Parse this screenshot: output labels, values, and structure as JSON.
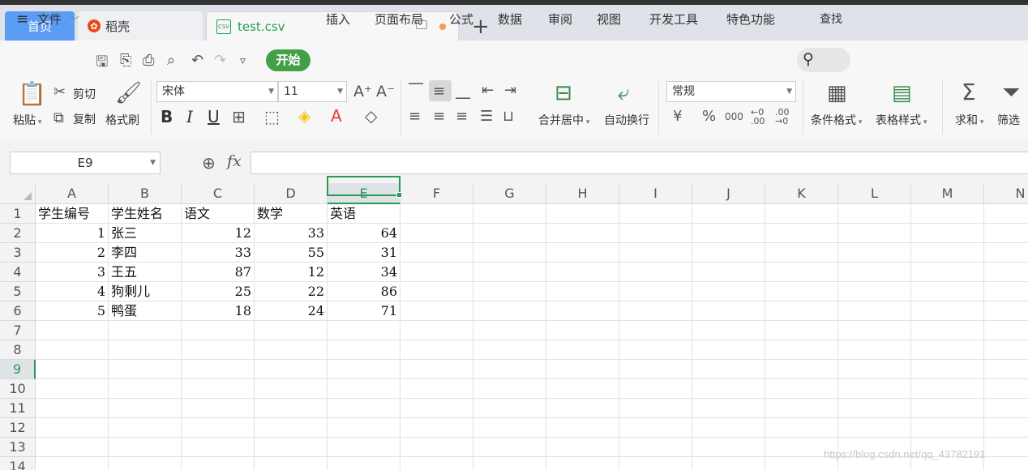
{
  "tabs": {
    "home": "首页",
    "docer": "稻壳",
    "file": "test.csv",
    "file_icon": "CSV",
    "new_tab": "+"
  },
  "menu": {
    "file": "文件",
    "start": "开始",
    "items": [
      "插入",
      "页面布局",
      "公式",
      "数据",
      "审阅",
      "视图",
      "开发工具",
      "特色功能"
    ],
    "search": "查找"
  },
  "ribbon": {
    "paste": "粘贴",
    "cut": "剪切",
    "copy": "复制",
    "format_painter": "格式刷",
    "font_name": "宋体",
    "font_size": "11",
    "merge_center": "合并居中",
    "wrap_text": "自动换行",
    "number_format": "常规",
    "conditional_format": "条件格式",
    "table_style": "表格样式",
    "sum": "求和",
    "filter": "筛选"
  },
  "formula_bar": {
    "name_box": "E9",
    "fx_label": "fx",
    "formula": ""
  },
  "sheet": {
    "columns": [
      "A",
      "B",
      "C",
      "D",
      "E",
      "F",
      "G",
      "H",
      "I",
      "J",
      "K",
      "L",
      "M",
      "N"
    ],
    "rows": [
      "1",
      "2",
      "3",
      "4",
      "5",
      "6",
      "7",
      "8",
      "9",
      "10",
      "11",
      "12",
      "13",
      "14"
    ],
    "selected_column": "E",
    "selected_row": "9",
    "header": [
      "学生编号",
      "学生姓名",
      "语文",
      "数学",
      "英语"
    ],
    "data": [
      [
        "1",
        "张三",
        "12",
        "33",
        "64"
      ],
      [
        "2",
        "李四",
        "33",
        "55",
        "31"
      ],
      [
        "3",
        "王五",
        "87",
        "12",
        "34"
      ],
      [
        "4",
        "狗剩儿",
        "25",
        "22",
        "86"
      ],
      [
        "5",
        "鸭蛋",
        "18",
        "24",
        "71"
      ]
    ]
  },
  "watermark": "https://blog.csdn.net/qq_43782191",
  "colors": {
    "accent_green": "#43a047",
    "home_tab": "#5b9cf5"
  }
}
